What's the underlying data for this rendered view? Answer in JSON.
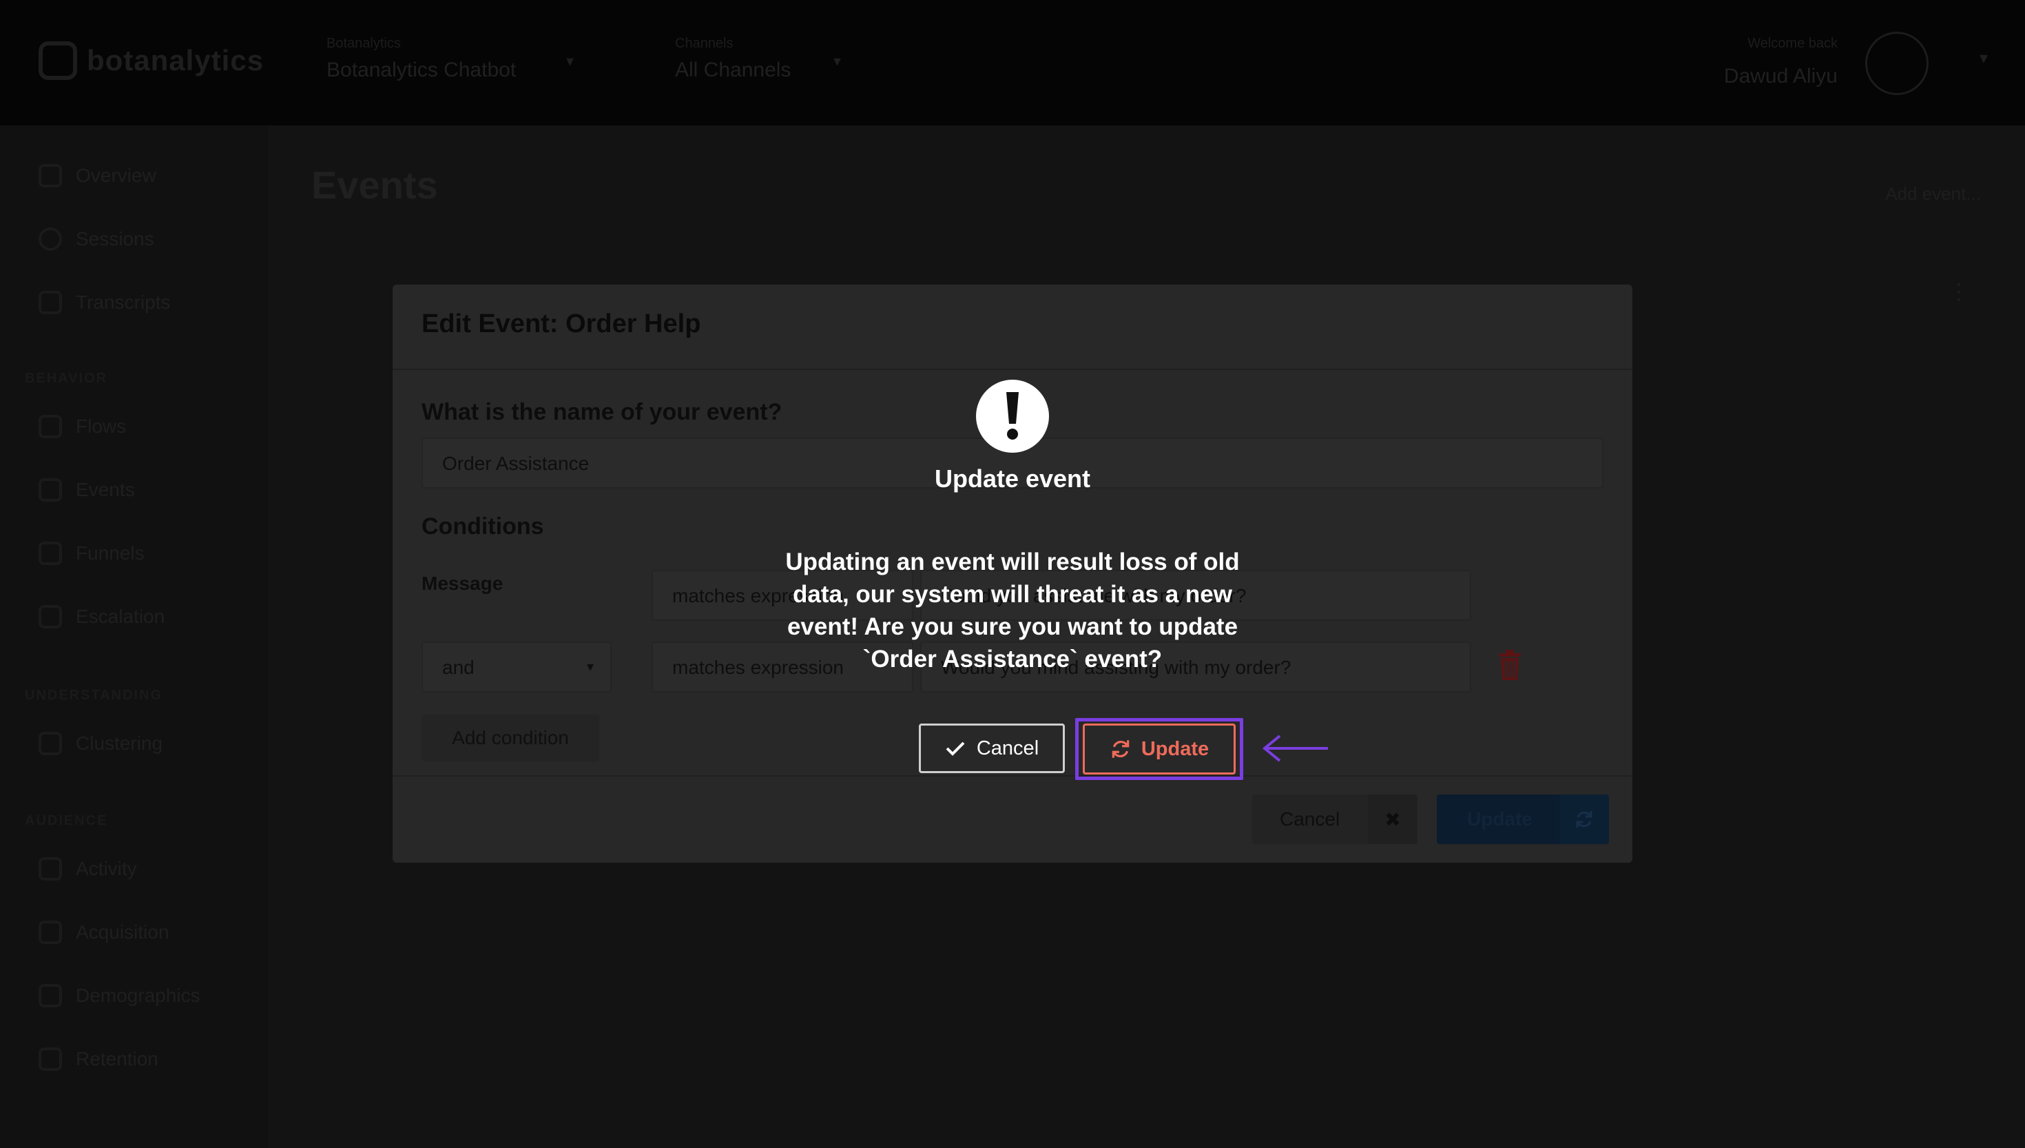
{
  "header": {
    "logo_text": "botanalytics",
    "bot_selector": {
      "label": "Botanalytics",
      "value": "Botanalytics Chatbot"
    },
    "channel_selector": {
      "label": "Channels",
      "value": "All Channels"
    },
    "user": {
      "label": "Welcome back",
      "name": "Dawud Aliyu"
    }
  },
  "sidebar": {
    "items_top": [
      {
        "label": "Overview",
        "icon": "dashboard-icon"
      },
      {
        "label": "Sessions",
        "icon": "clock-icon"
      },
      {
        "label": "Transcripts",
        "icon": "chat-icon"
      }
    ],
    "section_behavior": "BEHAVIOR",
    "items_behavior": [
      {
        "label": "Flows",
        "icon": "flow-icon"
      },
      {
        "label": "Events",
        "icon": "bolt-icon"
      },
      {
        "label": "Funnels",
        "icon": "funnel-icon"
      },
      {
        "label": "Escalation",
        "icon": "escalation-icon"
      }
    ],
    "section_understanding": "UNDERSTANDING",
    "items_understanding": [
      {
        "label": "Clustering",
        "icon": "cluster-icon"
      }
    ],
    "section_audience": "AUDIENCE",
    "items_audience": [
      {
        "label": "Activity",
        "icon": "activity-icon"
      },
      {
        "label": "Acquisition",
        "icon": "acquisition-icon"
      },
      {
        "label": "Demographics",
        "icon": "demographics-icon"
      },
      {
        "label": "Retention",
        "icon": "retention-icon"
      }
    ]
  },
  "content": {
    "title": "Events",
    "add_label": "Add event..."
  },
  "edit_modal": {
    "title": "Edit Event: Order Help",
    "name_question": "What is the name of your event?",
    "name_value": "Order Assistance",
    "conditions_title": "Conditions",
    "condition_rows": [
      {
        "subject": "Message",
        "operator": "matches expression",
        "value": "Could you assist me with my order?"
      },
      {
        "subject": "and",
        "operator": "matches expression",
        "value": "Would you mind assisting with my order?"
      }
    ],
    "add_condition_label": "Add condition",
    "cancel_label": "Cancel",
    "update_label": "Update"
  },
  "confirm_dialog": {
    "title": "Update event",
    "message": "Updating an event will result loss of old data, our system will threat it as a new event! Are you sure you want to update `Order Assistance` event?",
    "cancel_label": "Cancel",
    "update_label": "Update",
    "accent_color": "#ef6b5b",
    "highlight_color": "#7a3ee0"
  }
}
